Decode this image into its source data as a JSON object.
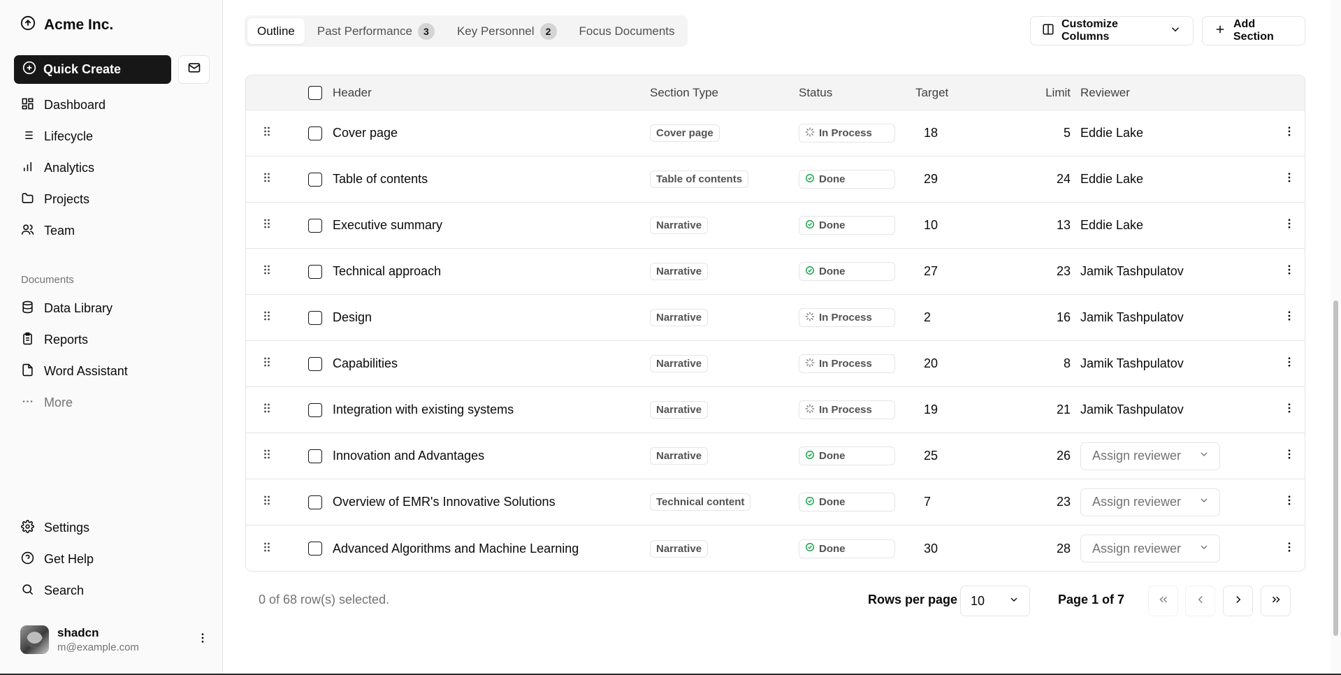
{
  "brand": {
    "name": "Acme Inc."
  },
  "sidebar": {
    "quick_create": "Quick Create",
    "main_items": [
      {
        "label": "Dashboard",
        "icon": "dashboard-icon"
      },
      {
        "label": "Lifecycle",
        "icon": "list-icon"
      },
      {
        "label": "Analytics",
        "icon": "bar-chart-icon"
      },
      {
        "label": "Projects",
        "icon": "folder-icon"
      },
      {
        "label": "Team",
        "icon": "users-icon"
      }
    ],
    "documents_label": "Documents",
    "doc_items": [
      {
        "label": "Data Library",
        "icon": "database-icon"
      },
      {
        "label": "Reports",
        "icon": "clipboard-icon"
      },
      {
        "label": "Word Assistant",
        "icon": "file-icon"
      },
      {
        "label": "More",
        "icon": "ellipsis-icon"
      }
    ],
    "bottom_items": [
      {
        "label": "Settings",
        "icon": "gear-icon"
      },
      {
        "label": "Get Help",
        "icon": "help-icon"
      },
      {
        "label": "Search",
        "icon": "search-icon"
      }
    ],
    "user": {
      "name": "shadcn",
      "email": "m@example.com"
    }
  },
  "tabs": [
    {
      "label": "Outline",
      "count": ""
    },
    {
      "label": "Past Performance",
      "count": "3"
    },
    {
      "label": "Key Personnel",
      "count": "2"
    },
    {
      "label": "Focus Documents",
      "count": ""
    }
  ],
  "toolbar": {
    "customize": "Customize Columns",
    "add": "Add Section"
  },
  "table": {
    "columns": {
      "header": "Header",
      "type": "Section Type",
      "status": "Status",
      "target": "Target",
      "limit": "Limit",
      "reviewer": "Reviewer"
    },
    "rows": [
      {
        "header": "Cover page",
        "type": "Cover page",
        "status": "In Process",
        "target": "18",
        "limit": "5",
        "reviewer": "Eddie Lake"
      },
      {
        "header": "Table of contents",
        "type": "Table of contents",
        "status": "Done",
        "target": "29",
        "limit": "24",
        "reviewer": "Eddie Lake"
      },
      {
        "header": "Executive summary",
        "type": "Narrative",
        "status": "Done",
        "target": "10",
        "limit": "13",
        "reviewer": "Eddie Lake"
      },
      {
        "header": "Technical approach",
        "type": "Narrative",
        "status": "Done",
        "target": "27",
        "limit": "23",
        "reviewer": "Jamik Tashpulatov"
      },
      {
        "header": "Design",
        "type": "Narrative",
        "status": "In Process",
        "target": "2",
        "limit": "16",
        "reviewer": "Jamik Tashpulatov"
      },
      {
        "header": "Capabilities",
        "type": "Narrative",
        "status": "In Process",
        "target": "20",
        "limit": "8",
        "reviewer": "Jamik Tashpulatov"
      },
      {
        "header": "Integration with existing systems",
        "type": "Narrative",
        "status": "In Process",
        "target": "19",
        "limit": "21",
        "reviewer": "Jamik Tashpulatov"
      },
      {
        "header": "Innovation and Advantages",
        "type": "Narrative",
        "status": "Done",
        "target": "25",
        "limit": "26",
        "reviewer": ""
      },
      {
        "header": "Overview of EMR's Innovative Solutions",
        "type": "Technical content",
        "status": "Done",
        "target": "7",
        "limit": "23",
        "reviewer": ""
      },
      {
        "header": "Advanced Algorithms and Machine Learning",
        "type": "Narrative",
        "status": "Done",
        "target": "30",
        "limit": "28",
        "reviewer": ""
      }
    ],
    "assign_placeholder": "Assign reviewer"
  },
  "footer": {
    "selection": "0 of 68 row(s) selected.",
    "rows_per_page_label": "Rows per page",
    "rows_per_page_value": "10",
    "page_info": "Page 1 of 7"
  },
  "colors": {
    "done": "#16a34a",
    "primary": "#171717"
  }
}
